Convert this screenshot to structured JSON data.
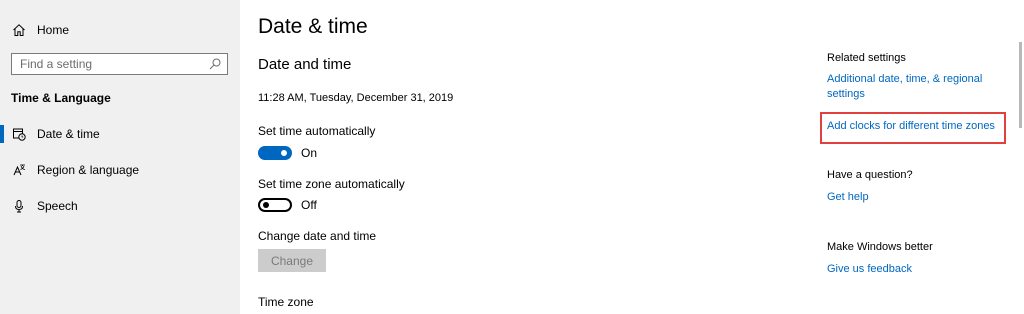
{
  "sidebar": {
    "home_label": "Home",
    "search_placeholder": "Find a setting",
    "section_title": "Time & Language",
    "items": [
      {
        "label": "Date & time",
        "icon": "clock-calendar-icon"
      },
      {
        "label": "Region & language",
        "icon": "language-icon"
      },
      {
        "label": "Speech",
        "icon": "microphone-icon"
      }
    ]
  },
  "main": {
    "title": "Date & time",
    "subtitle": "Date and time",
    "current_datetime": "11:28 AM, Tuesday, December 31, 2019",
    "set_time_auto_label": "Set time automatically",
    "set_time_auto_state": "On",
    "set_timezone_auto_label": "Set time zone automatically",
    "set_timezone_auto_state": "Off",
    "change_datetime_label": "Change date and time",
    "change_button": "Change",
    "time_zone_label": "Time zone"
  },
  "related": {
    "heading": "Related settings",
    "link_additional_line1": "Additional date, time, & regional",
    "link_additional_line2": "settings",
    "link_add_clocks": "Add clocks for different time zones",
    "question_heading": "Have a question?",
    "get_help": "Get help",
    "better_heading": "Make Windows better",
    "feedback": "Give us feedback"
  },
  "colors": {
    "accent": "#0067c0",
    "highlight_box": "#e0413f",
    "sidebar_bg": "#f0f0f0"
  }
}
